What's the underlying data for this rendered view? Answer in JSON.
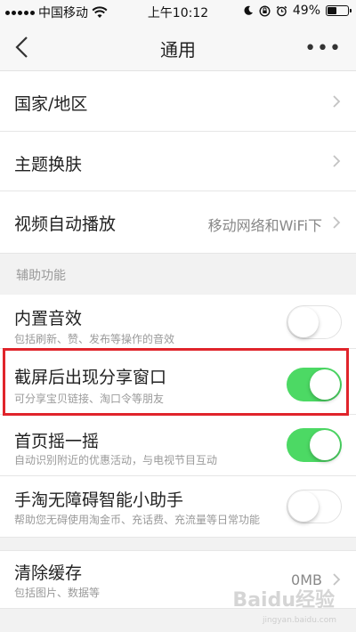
{
  "status_bar": {
    "carrier": "中国移动",
    "time": "上午10:12",
    "battery_percent": "49%",
    "battery_level": 0.49
  },
  "nav": {
    "title": "通用"
  },
  "rows": {
    "region": {
      "label": "国家/地区"
    },
    "theme": {
      "label": "主题换肤"
    },
    "autoplay": {
      "label": "视频自动播放",
      "value": "移动网络和WiFi下"
    }
  },
  "section": {
    "title": "辅助功能"
  },
  "toggles": {
    "sound": {
      "label": "内置音效",
      "sub": "包括刷新、赞、发布等操作的音效",
      "on": false
    },
    "screenshot_share": {
      "label": "截屏后出现分享窗口",
      "sub": "可分享宝贝链接、淘口令等朋友",
      "on": true
    },
    "shake": {
      "label": "首页摇一摇",
      "sub": "自动识别附近的优惠活动，与电视节目互动",
      "on": true
    },
    "assistant": {
      "label": "手淘无障碍智能小助手",
      "sub": "帮助您无碍使用淘金币、充话费、充流量等日常功能",
      "on": false
    }
  },
  "cache": {
    "label": "清除缓存",
    "sub": "包括图片、数据等",
    "value": "0MB"
  },
  "watermark": {
    "logo": "Baidu经验",
    "url": "jingyan.baidu.com"
  },
  "colors": {
    "toggle_on": "#4cd964",
    "highlight": "#e0242b"
  }
}
